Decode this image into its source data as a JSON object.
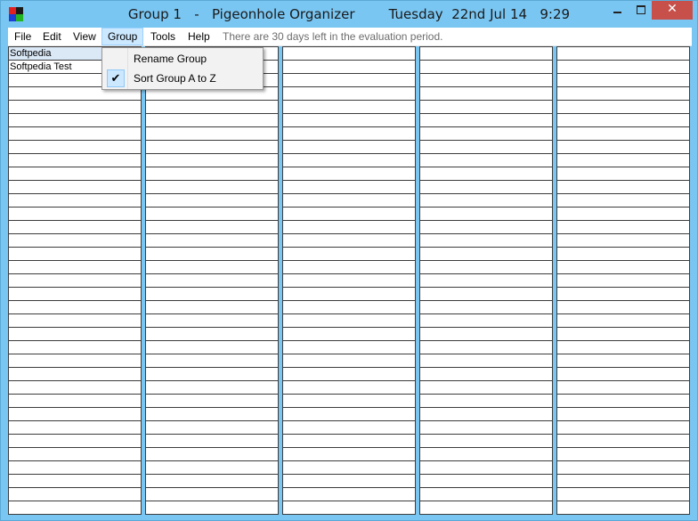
{
  "window": {
    "group_name": "Group 1",
    "separator": "-",
    "app_name": "Pigeonhole Organizer",
    "date": "Tuesday  22nd Jul 14",
    "time": "9:29",
    "close_glyph": "✕"
  },
  "menu": {
    "file": "File",
    "edit": "Edit",
    "view": "View",
    "group": "Group",
    "tools": "Tools",
    "help": "Help",
    "eval_notice": "There are 30 days left in the evaluation period."
  },
  "dropdown": {
    "rename_group": "Rename Group",
    "sort_group": "Sort Group A to Z",
    "sort_checked": true,
    "check_glyph": "✔"
  },
  "columns": [
    {
      "entries": [
        "Softpedia",
        "Softpedia Test"
      ]
    },
    {
      "entries": []
    },
    {
      "entries": []
    },
    {
      "entries": []
    },
    {
      "entries": []
    }
  ],
  "colors": {
    "frame": "#7ac6f2",
    "menu_highlight": "#cce8ff",
    "close_button": "#c7504a",
    "selected_row": "#dbe9f7"
  }
}
